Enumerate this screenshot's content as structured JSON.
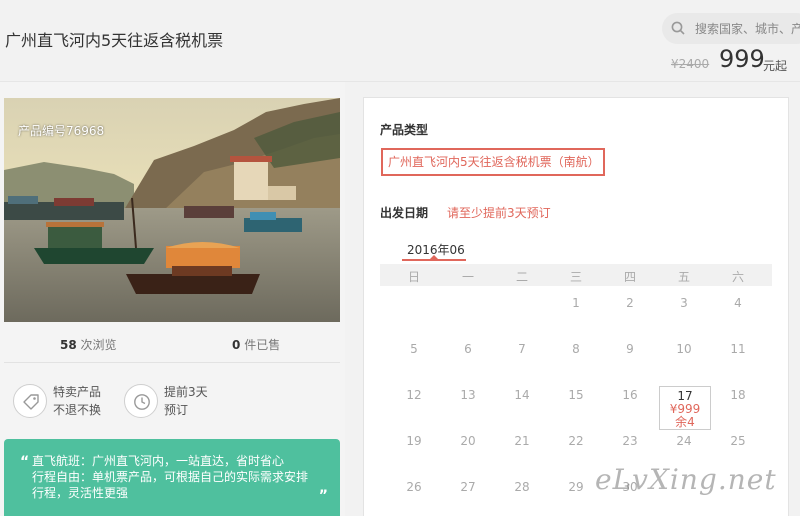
{
  "header": {
    "title": "广州直飞河内5天往返含税机票",
    "search_placeholder": "搜索国家、城市、产",
    "old_price": "¥2400",
    "price": "999",
    "price_unit": "元起"
  },
  "gallery": {
    "product_no": "产品编号76968"
  },
  "stats": {
    "views_count": "58",
    "views_label": "次浏览",
    "sold_count": "0",
    "sold_label": "件已售"
  },
  "features": [
    {
      "line1": "特卖产品",
      "line2": "不退不换",
      "icon": "tag-icon"
    },
    {
      "line1": "提前3天",
      "line2": "预订",
      "icon": "clock-icon"
    }
  ],
  "description": {
    "open_quote": "“",
    "close_quote": "”",
    "lines": [
      "直飞航班：广州直飞河内，一站直达，省时省心",
      "行程自由：单机票产品，可根据自己的实际需求安排",
      "行程，灵活性更强"
    ]
  },
  "booking": {
    "type_label": "产品类型",
    "type_option": "广州直飞河内5天往返含税机票（南航）",
    "date_label": "出发日期",
    "date_note": "请至少提前3天预订",
    "month": "2016年06",
    "weekdays": [
      "日",
      "一",
      "二",
      "三",
      "四",
      "五",
      "六"
    ],
    "weeks": [
      [
        "",
        "",
        "",
        "1",
        "2",
        "3",
        "4"
      ],
      [
        "5",
        "6",
        "7",
        "8",
        "9",
        "10",
        "11"
      ],
      [
        "12",
        "13",
        "14",
        "15",
        "16",
        "17",
        "18"
      ],
      [
        "19",
        "20",
        "21",
        "22",
        "23",
        "24",
        "25"
      ],
      [
        "26",
        "27",
        "28",
        "29",
        "30",
        "",
        ""
      ]
    ],
    "selected": {
      "day": "17",
      "price": "¥999",
      "remaining": "余4"
    }
  },
  "watermark": "eLvXing.net",
  "colors": {
    "accent": "#e0675b",
    "green": "#4fc09e"
  }
}
